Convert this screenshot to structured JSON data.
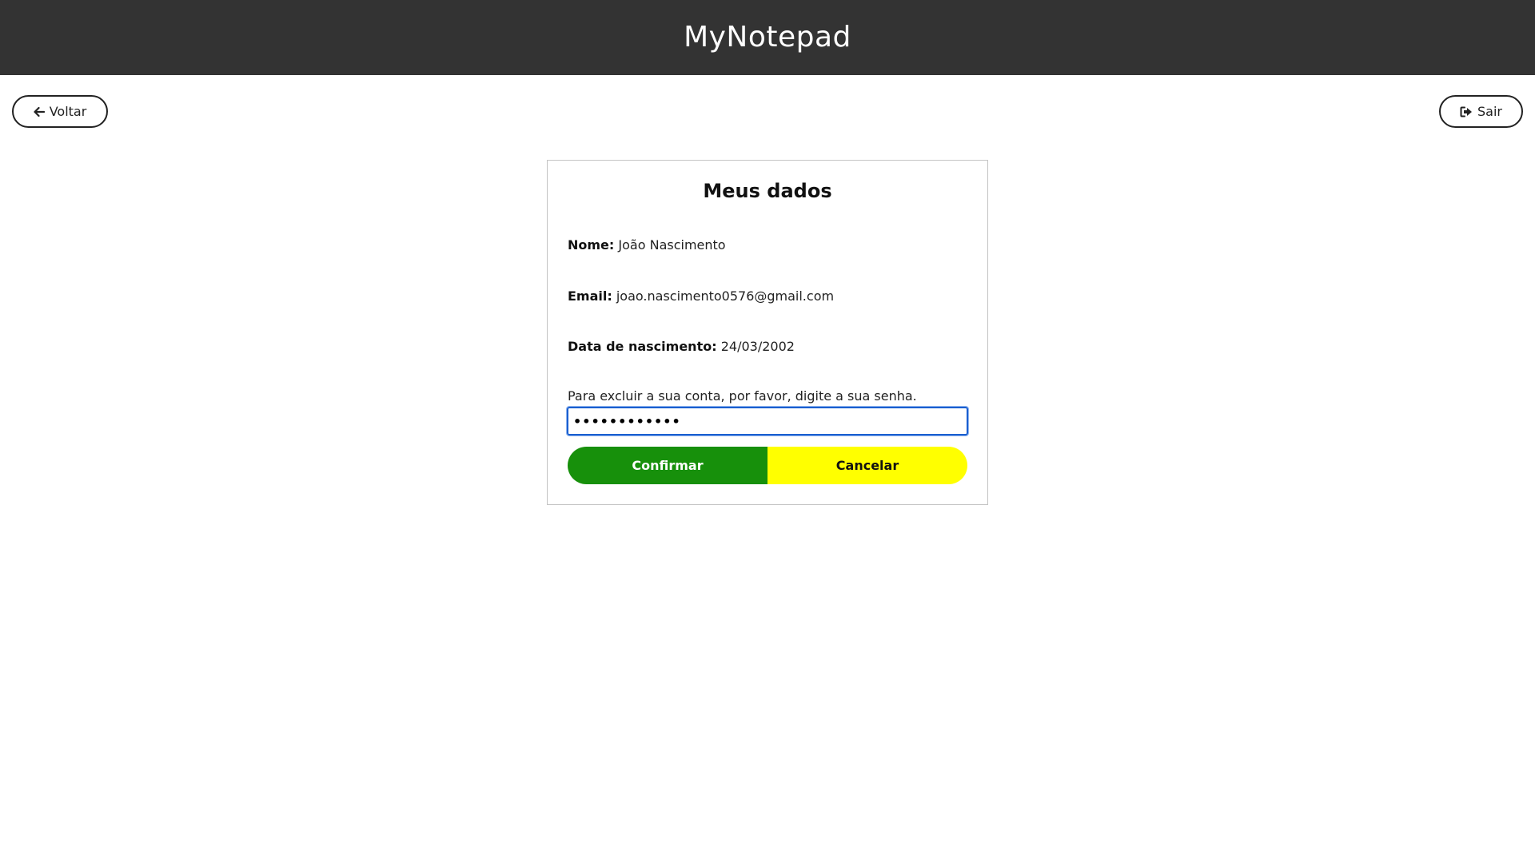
{
  "header": {
    "app_title": "MyNotepad",
    "background_color": "#333333"
  },
  "nav": {
    "back_label": "Voltar",
    "back_icon": "arrow-left-icon",
    "logout_label": "Sair",
    "logout_icon": "sign-out-icon"
  },
  "profile": {
    "title": "Meus dados",
    "name_label": "Nome:",
    "name_value": "João Nascimento",
    "email_label": "Email:",
    "email_value": "joao.nascimento0576@gmail.com",
    "birth_label": "Data de nascimento:",
    "birth_value": "24/03/2002",
    "delete_instruction": "Para excluir a sua conta, por favor, digite a sua senha.",
    "password_value": "••••••••••••"
  },
  "actions": {
    "confirm_label": "Confirmar",
    "confirm_color": "#17900b",
    "cancel_label": "Cancelar",
    "cancel_color": "#ffff00"
  }
}
